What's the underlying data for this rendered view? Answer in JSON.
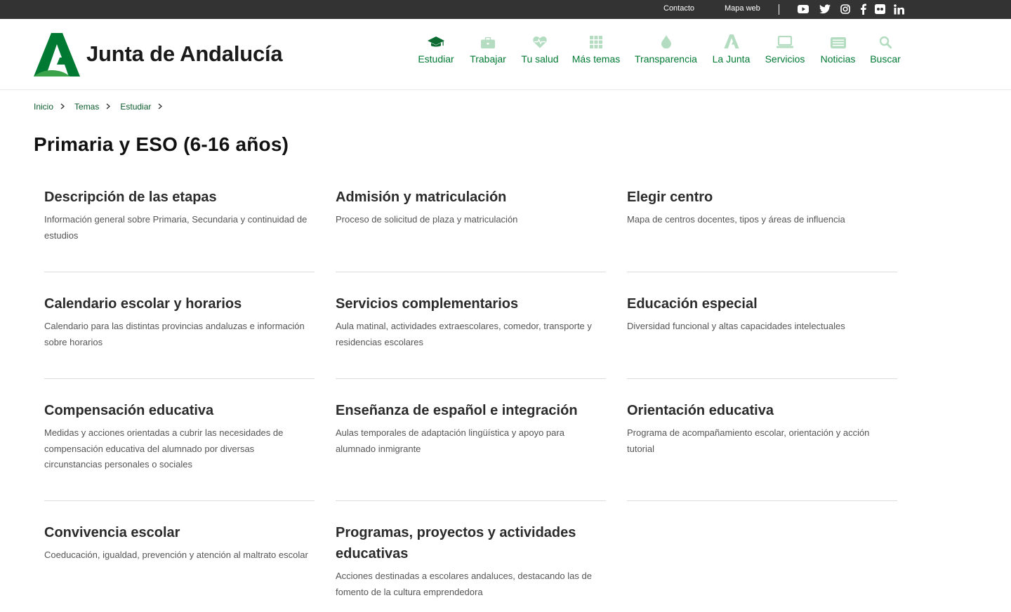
{
  "topbar": {
    "contact": "Contacto",
    "sitemap": "Mapa web",
    "social": [
      "youtube-icon",
      "twitter-icon",
      "instagram-icon",
      "facebook-icon",
      "flickr-icon",
      "linkedin-icon"
    ]
  },
  "header": {
    "brand": "Junta de Andalucía",
    "nav": [
      {
        "label": "Estudiar",
        "icon": "graduation-cap-icon"
      },
      {
        "label": "Trabajar",
        "icon": "briefcase-icon"
      },
      {
        "label": "Tu salud",
        "icon": "heart-pulse-icon"
      },
      {
        "label": "Más temas",
        "icon": "grid-icon"
      },
      {
        "label": "Transparencia",
        "icon": "drop-icon"
      },
      {
        "label": "La Junta",
        "icon": "junta-a-icon"
      },
      {
        "label": "Servicios",
        "icon": "laptop-icon"
      },
      {
        "label": "Noticias",
        "icon": "newspaper-icon"
      },
      {
        "label": "Buscar",
        "icon": "search-icon"
      }
    ]
  },
  "colors": {
    "brand_green": "#007a33",
    "active_icon": "#0b6b30",
    "inactive_icon": "#b3dcc0",
    "topbar": "#333333"
  },
  "breadcrumb": [
    "Inicio",
    "Temas",
    "Estudiar"
  ],
  "page": {
    "title": "Primaria y ESO (6-16 años)"
  },
  "cards": [
    {
      "title": "Descripción de las etapas",
      "desc": "Información general sobre Primaria, Secundaria y continuidad de estudios"
    },
    {
      "title": "Admisión y matriculación",
      "desc": "Proceso de solicitud de plaza y matriculación"
    },
    {
      "title": "Elegir centro",
      "desc": "Mapa de centros docentes, tipos y áreas de influencia"
    },
    {
      "title": "Calendario escolar y horarios",
      "desc": "Calendario para las distintas provincias andaluzas e información sobre horarios"
    },
    {
      "title": "Servicios complementarios",
      "desc": "Aula matinal, actividades extraescolares, comedor, transporte y residencias escolares"
    },
    {
      "title": "Educación especial",
      "desc": "Diversidad funcional y altas capacidades intelectuales"
    },
    {
      "title": "Compensación educativa",
      "desc": "Medidas y acciones orientadas a cubrir las necesidades de compensación educativa del alumnado por diversas circunstancias personales o sociales"
    },
    {
      "title": "Enseñanza de español e integración",
      "desc": "Aulas temporales de adaptación lingüística y apoyo para alumnado inmigrante"
    },
    {
      "title": "Orientación educativa",
      "desc": "Programa de acompañamiento escolar, orientación y acción tutorial"
    },
    {
      "title": "Convivencia escolar",
      "desc": "Coeducación, igualdad, prevención y atención al maltrato escolar"
    },
    {
      "title": "Programas, proyectos y actividades educativas",
      "desc": "Acciones destinadas a escolares andaluces, destacando las de fomento de la cultura emprendedora"
    }
  ]
}
